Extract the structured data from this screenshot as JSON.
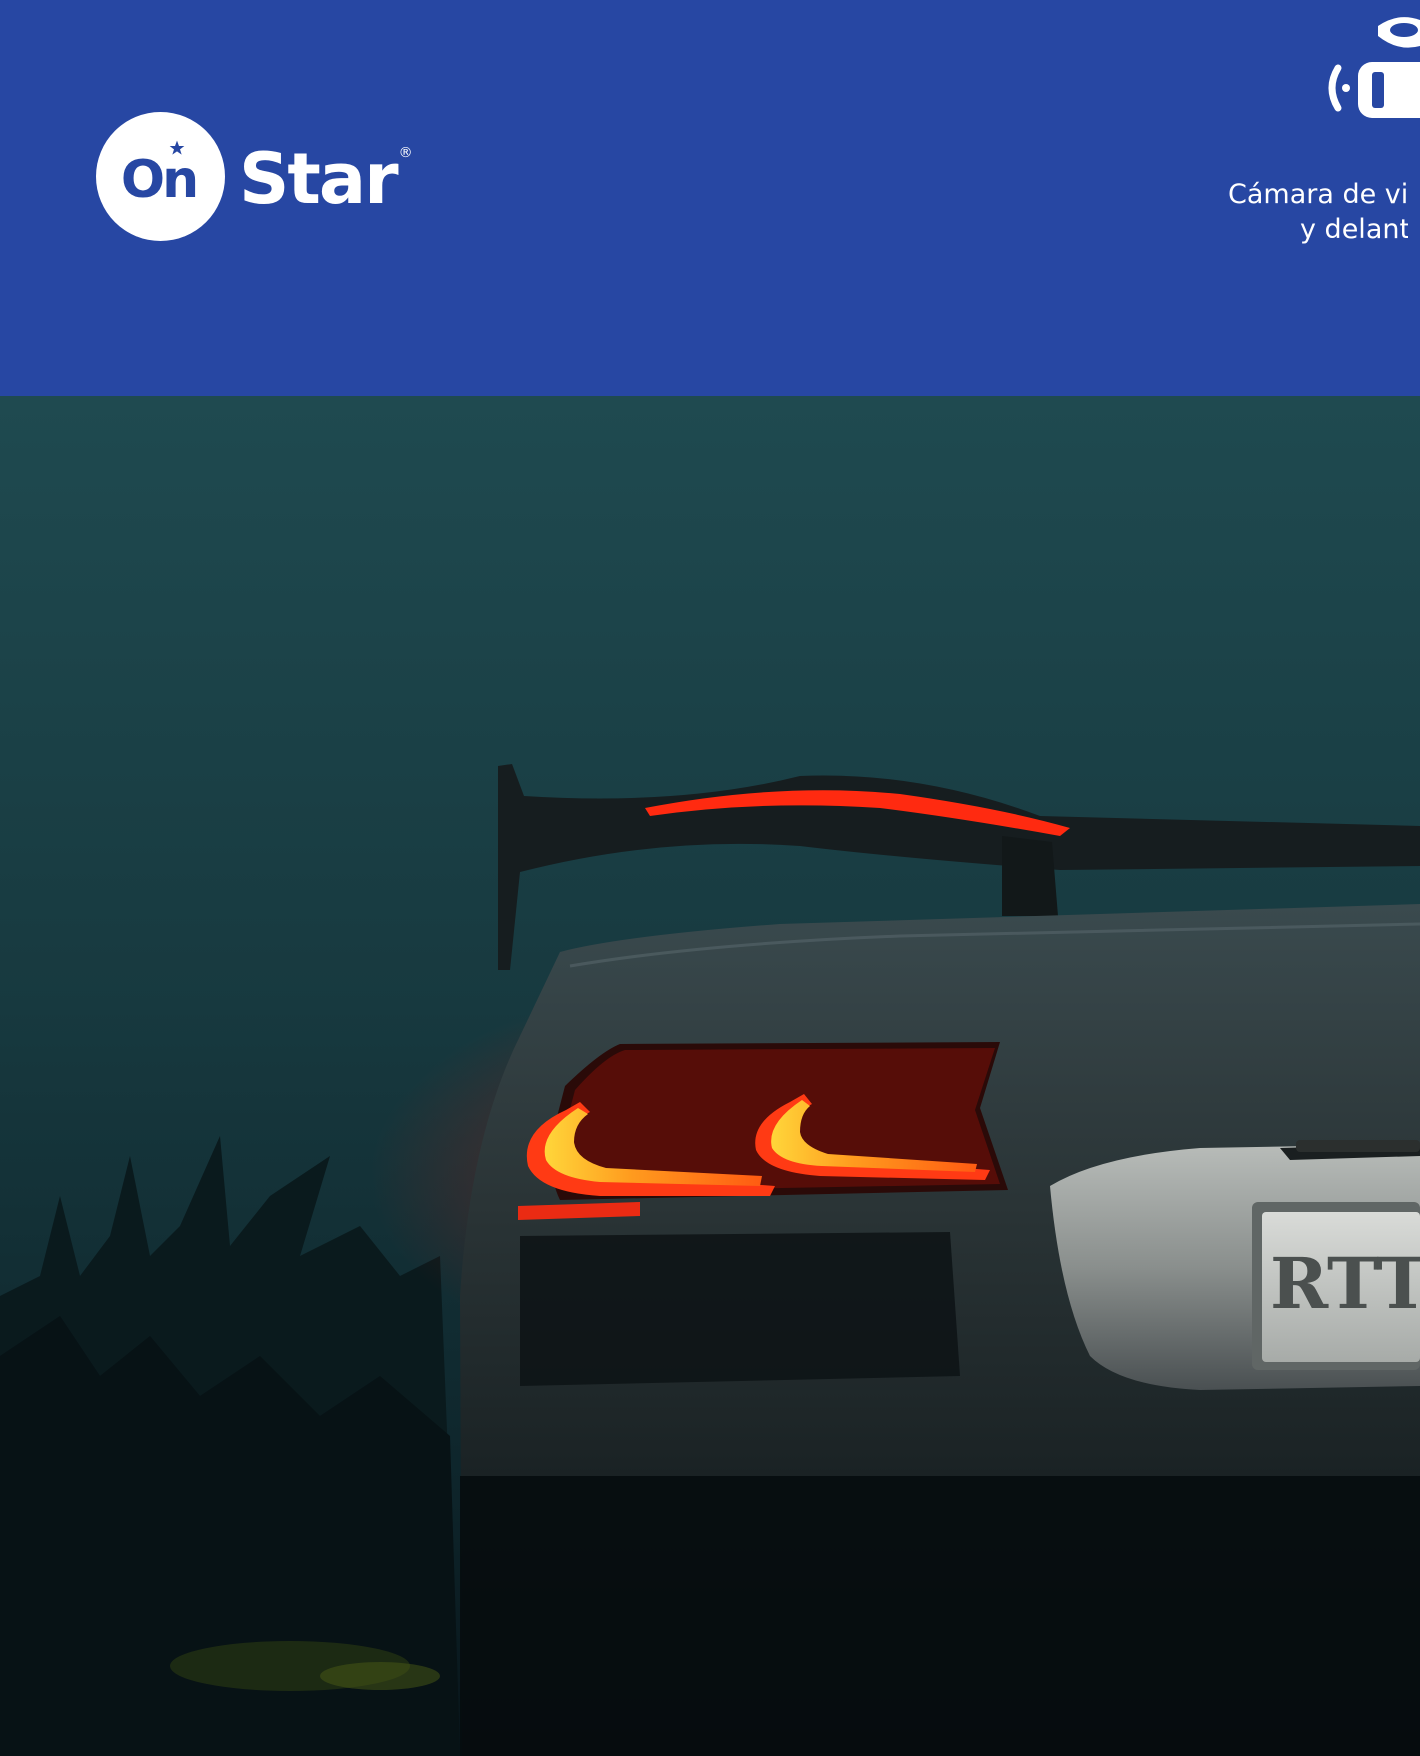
{
  "header": {
    "logo": {
      "on": "On",
      "star": "Star",
      "registered": "®"
    },
    "feature": {
      "icon": "camera-signal-icon",
      "caption_line1": "Cámara de vi",
      "caption_line2": "y delant"
    }
  },
  "hero": {
    "image": "sports-car-rear-night-photo",
    "plate_text": "RTT"
  },
  "colors": {
    "header_bg": "#2747a3",
    "text": "#ffffff",
    "taillight": "#ff2a10"
  }
}
